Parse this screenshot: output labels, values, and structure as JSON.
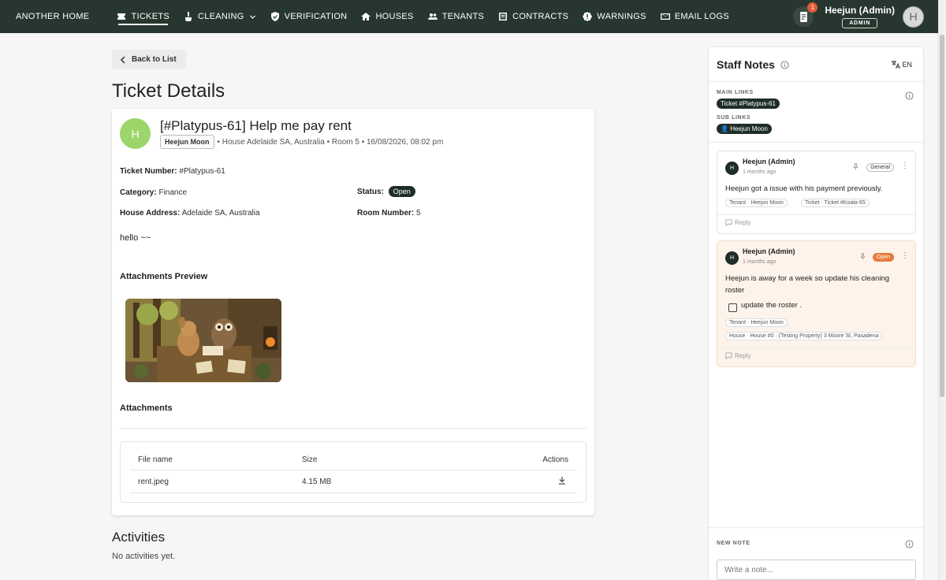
{
  "nav": {
    "brand": "ANOTHER HOME",
    "items": [
      {
        "label": "TICKETS",
        "icon": "ticket-icon",
        "active": true
      },
      {
        "label": "CLEANING",
        "icon": "broom-icon",
        "active": false
      },
      {
        "label": "VERIFICATION",
        "icon": "shield-check-icon",
        "active": false
      },
      {
        "label": "HOUSES",
        "icon": "house-icon",
        "active": false
      },
      {
        "label": "TENANTS",
        "icon": "people-icon",
        "active": false
      },
      {
        "label": "CONTRACTS",
        "icon": "contract-icon",
        "active": false
      },
      {
        "label": "WARNINGS",
        "icon": "warning-icon",
        "active": false
      },
      {
        "label": "EMAIL LOGS",
        "icon": "mail-icon",
        "active": false
      }
    ],
    "notification_count": "1",
    "user_name": "Heejun (Admin)",
    "user_role": "ADMIN",
    "avatar_initial": "H"
  },
  "back_label": "Back to List",
  "page_title": "Ticket Details",
  "ticket": {
    "avatar_initial": "H",
    "title": "[#Platypus-61] Help me pay rent",
    "author": "Heejun Moon",
    "meta": "• House Adelaide SA, Australia • Room 5 • 16/08/2026, 08:02 pm",
    "number_label": "Ticket Number:",
    "number_value": "#Platypus-61",
    "category_label": "Category:",
    "category_value": "Finance",
    "status_label": "Status:",
    "status_value": "Open",
    "address_label": "House Address:",
    "address_value": "Adelaide SA, Australia",
    "room_label": "Room Number:",
    "room_value": "5",
    "description": "hello ~~",
    "attachments_preview_title": "Attachments Preview",
    "attachments_title": "Attachments",
    "table_headers": {
      "file_name": "File name",
      "size": "Size",
      "actions": "Actions"
    },
    "files": [
      {
        "name": "rent.jpeg",
        "size": "4.15 MB"
      }
    ]
  },
  "activities": {
    "title": "Activities",
    "empty": "No activities yet."
  },
  "staff_notes": {
    "title": "Staff Notes",
    "lang": "EN",
    "main_links_label": "MAIN LINKS",
    "main_link": "Ticket #Platypus-61",
    "sub_links_label": "SUB LINKS",
    "sub_link": "Heejun Moon",
    "notes": [
      {
        "author": "Heejun (Admin)",
        "time": "1 months ago",
        "tag": "General",
        "text": "Heejun got a issue with his payment previously.",
        "chips": [
          "Tenant · Heejun Moon",
          "Ticket · Ticket #Koala-65"
        ],
        "reply": "Reply"
      },
      {
        "author": "Heejun (Admin)",
        "time": "1 months ago",
        "tag": "Open",
        "text": "Heejun is away for a week so update his cleaning roster",
        "checklist_item": "update the roster .",
        "chips": [
          "Tenant · Heejun Moon",
          "House · House #0 · (Testing Property) 3 Moore St, Pasadena"
        ],
        "reply": "Reply"
      }
    ],
    "new_note_label": "NEW NOTE",
    "new_note_placeholder": "Write a note..."
  },
  "colors": {
    "nav_bg": "#27372f",
    "dark_pill": "#1e2e27",
    "avatar_green": "#9dd56a",
    "open_tag": "#e87a3a",
    "note_highlight_bg": "#fdf3ea"
  }
}
